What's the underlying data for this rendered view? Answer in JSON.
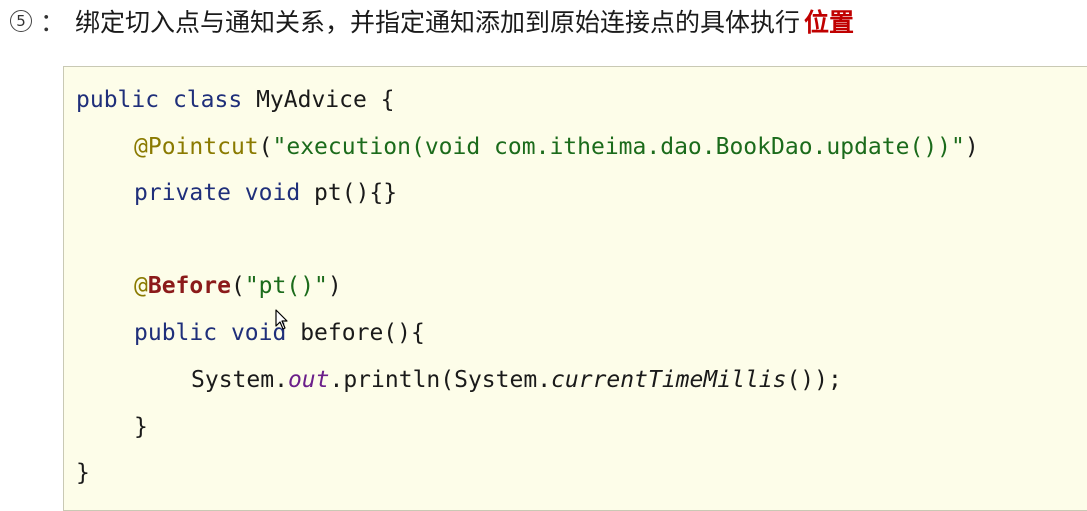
{
  "heading": {
    "step_number": "5",
    "colon": "：",
    "text": "绑定切入点与通知关系，并指定通知添加到原始连接点的具体执行",
    "emphasis": "位置"
  },
  "code": {
    "line1": {
      "kw1": "public",
      "kw2": "class",
      "name": "MyAdvice {"
    },
    "line2": {
      "at": "@",
      "ann": "Pointcut",
      "open": "(",
      "str": "\"execution(void com.itheima.dao.BookDao.update())\"",
      "close": ")"
    },
    "line3": {
      "kw1": "private",
      "kw2": "void",
      "rest": "pt(){}"
    },
    "line5": {
      "at": "@",
      "ann": "Before",
      "open": "(",
      "str": "\"pt()\"",
      "close": ")"
    },
    "line6": {
      "kw1": "public",
      "kw2": "void",
      "rest": "before(){"
    },
    "line7": {
      "p1": "System.",
      "field": "out",
      "p2": ".println(System.",
      "method": "currentTimeMillis",
      "p3": "());"
    },
    "line8": {
      "brace": "}"
    },
    "line9": {
      "brace": "}"
    }
  },
  "colors": {
    "keyword": "#1f2f7a",
    "annotation_at": "#8a7a00",
    "annotation_name": "#8b1a1a",
    "string": "#1b6b1b",
    "field": "#6b1f8a",
    "emphasis": "#c00000",
    "code_background": "#fdfde9"
  },
  "icons": {
    "cursor": "mouse-pointer-icon"
  }
}
